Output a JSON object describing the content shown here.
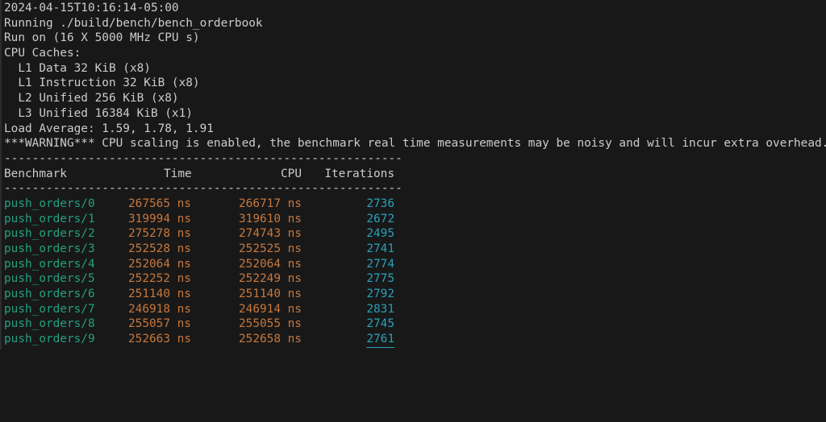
{
  "header": {
    "timestamp": "2024-04-15T10:16:14-05:00",
    "running": "Running ./build/bench/bench_orderbook",
    "run_on": "Run on (16 X 5000 MHz CPU s)",
    "cpu_caches_title": "CPU Caches:",
    "caches": [
      "  L1 Data 32 KiB (x8)",
      "  L1 Instruction 32 KiB (x8)",
      "  L2 Unified 256 KiB (x8)",
      "  L3 Unified 16384 KiB (x1)"
    ],
    "load_average": "Load Average: 1.59, 1.78, 1.91",
    "warning": "***WARNING*** CPU scaling is enabled, the benchmark real time measurements may be noisy and will incur extra overhead."
  },
  "separator": "---------------------------------------------------------",
  "table": {
    "headers": {
      "benchmark": "Benchmark",
      "time": "Time",
      "cpu": "CPU",
      "iterations": "Iterations"
    },
    "rows": [
      {
        "name": "push_orders/0",
        "time": "267565 ns",
        "cpu": "266717 ns",
        "iterations": "2736"
      },
      {
        "name": "push_orders/1",
        "time": "319994 ns",
        "cpu": "319610 ns",
        "iterations": "2672"
      },
      {
        "name": "push_orders/2",
        "time": "275278 ns",
        "cpu": "274743 ns",
        "iterations": "2495"
      },
      {
        "name": "push_orders/3",
        "time": "252528 ns",
        "cpu": "252525 ns",
        "iterations": "2741"
      },
      {
        "name": "push_orders/4",
        "time": "252064 ns",
        "cpu": "252064 ns",
        "iterations": "2774"
      },
      {
        "name": "push_orders/5",
        "time": "252252 ns",
        "cpu": "252249 ns",
        "iterations": "2775"
      },
      {
        "name": "push_orders/6",
        "time": "251140 ns",
        "cpu": "251140 ns",
        "iterations": "2792"
      },
      {
        "name": "push_orders/7",
        "time": "246918 ns",
        "cpu": "246914 ns",
        "iterations": "2831"
      },
      {
        "name": "push_orders/8",
        "time": "255057 ns",
        "cpu": "255055 ns",
        "iterations": "2745"
      },
      {
        "name": "push_orders/9",
        "time": "252663 ns",
        "cpu": "252658 ns",
        "iterations": "2761"
      }
    ]
  },
  "colors": {
    "background": "#181818",
    "text": "#cccccc",
    "benchmark_name": "#23a07d",
    "time_value": "#c7783d",
    "iterations_value": "#2aa0b8"
  }
}
